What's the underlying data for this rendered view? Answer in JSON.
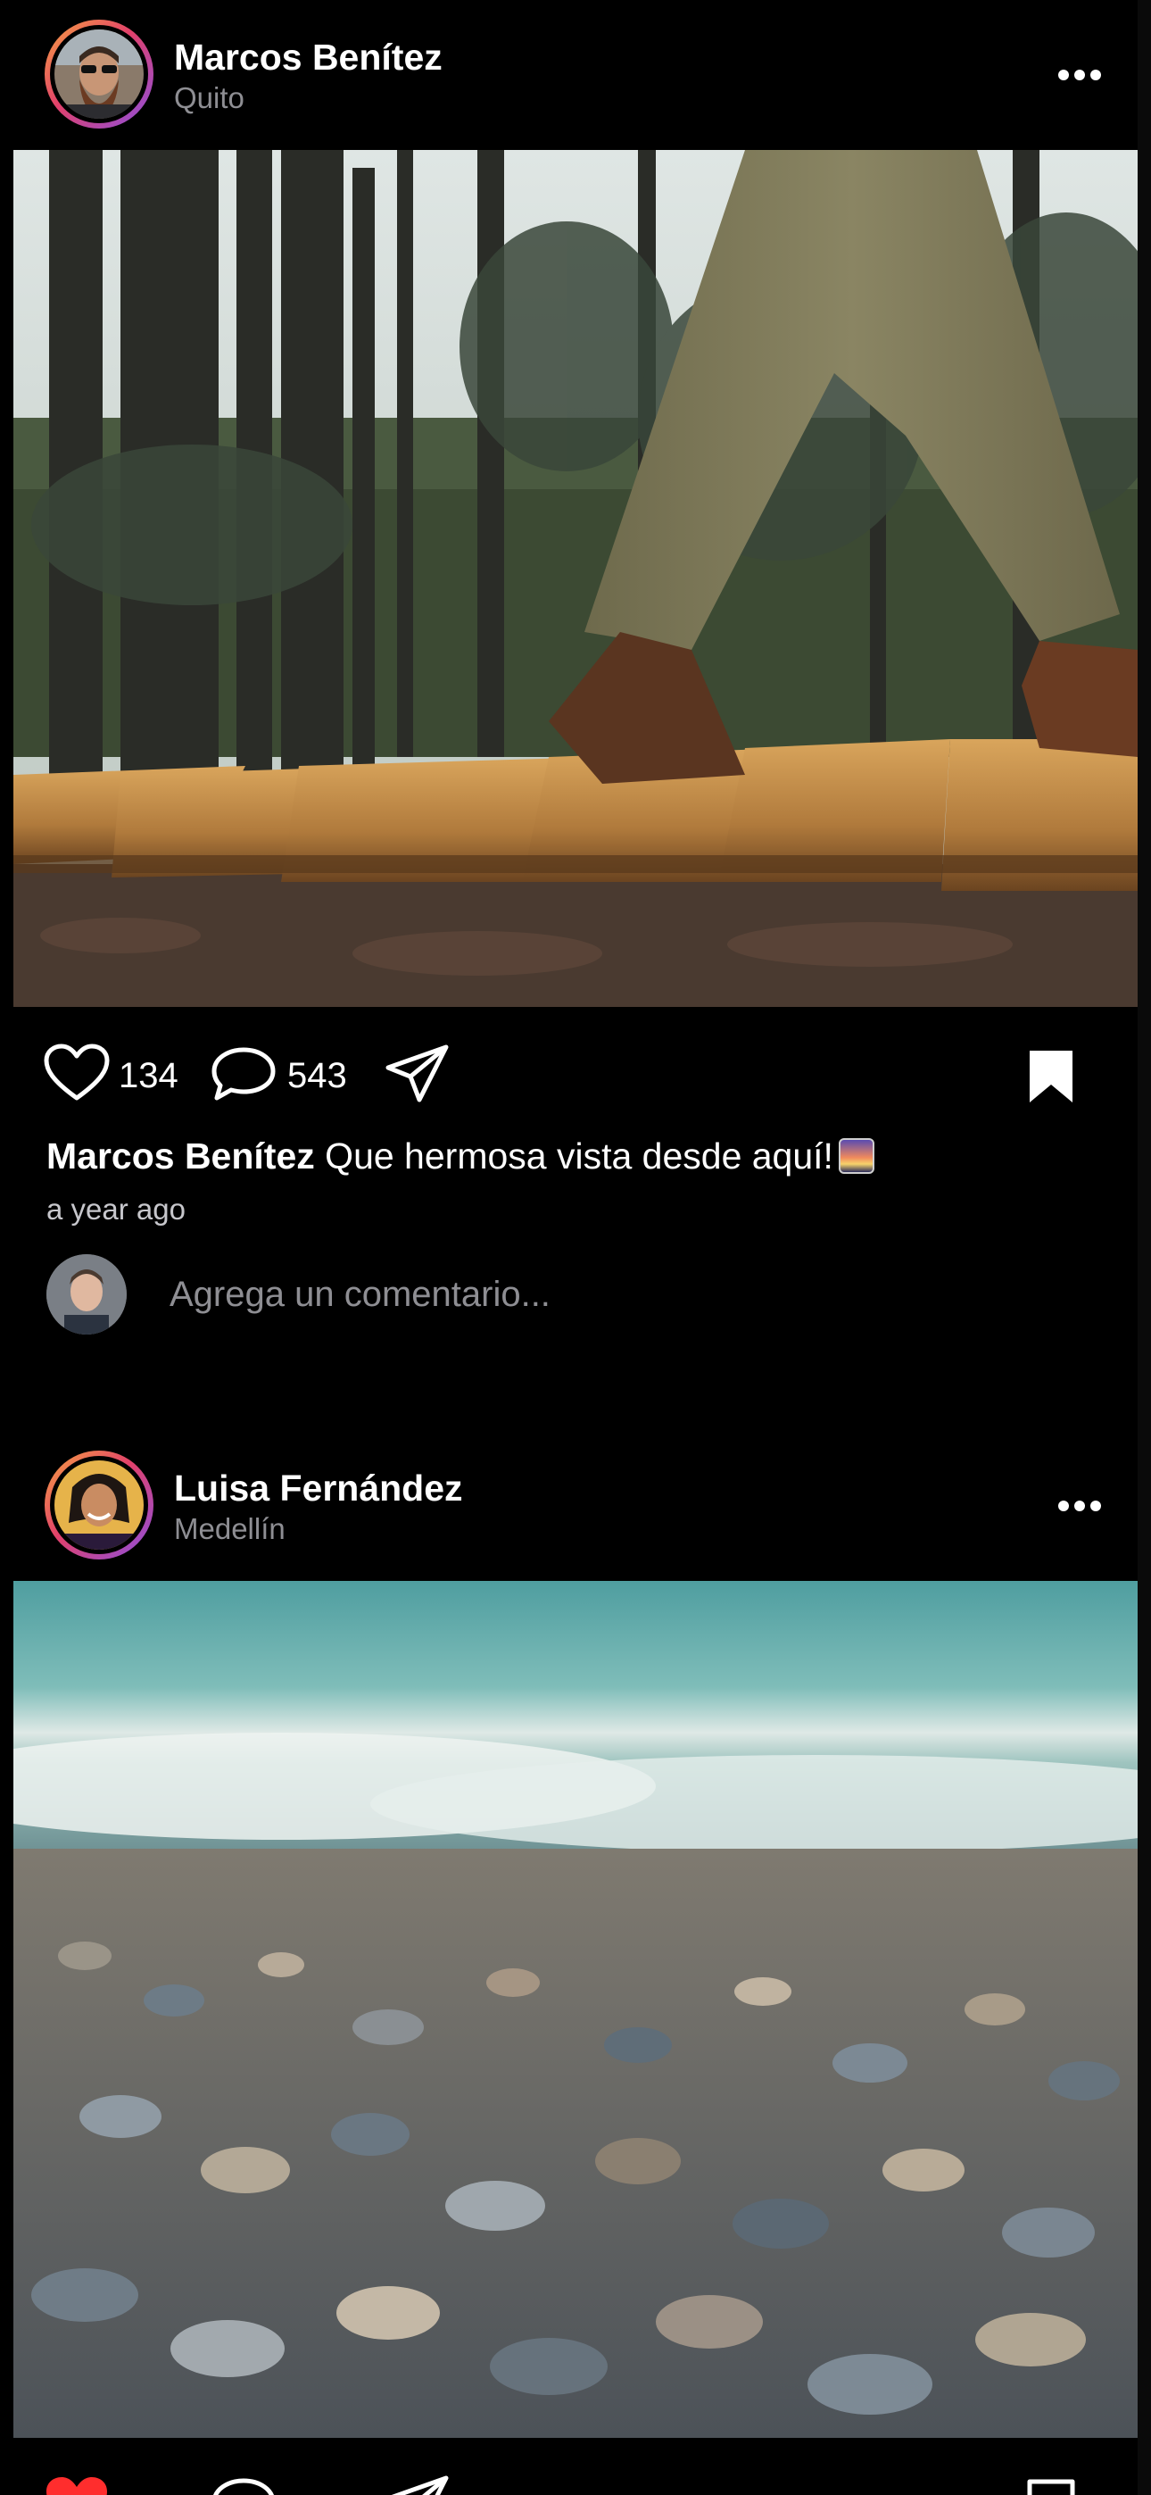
{
  "posts": [
    {
      "username": "Marcos Benítez",
      "location": "Quito",
      "likes": "134",
      "comments": "543",
      "caption_user": "Marcos Benítez",
      "caption_text": "Que hermosa vista desde aquí!",
      "timestamp": "a year ago",
      "comment_placeholder": "Agrega un comentario...",
      "saved": true
    },
    {
      "username": "Luisa Fernández",
      "location": "Medellín",
      "liked": true
    }
  ],
  "colors": {
    "background": "#000000",
    "secondary_text": "#8e8e93",
    "like_active": "#ff2d2d"
  },
  "icons": [
    "more-icon",
    "heart-icon",
    "comment-icon",
    "send-icon",
    "bookmark-icon"
  ]
}
